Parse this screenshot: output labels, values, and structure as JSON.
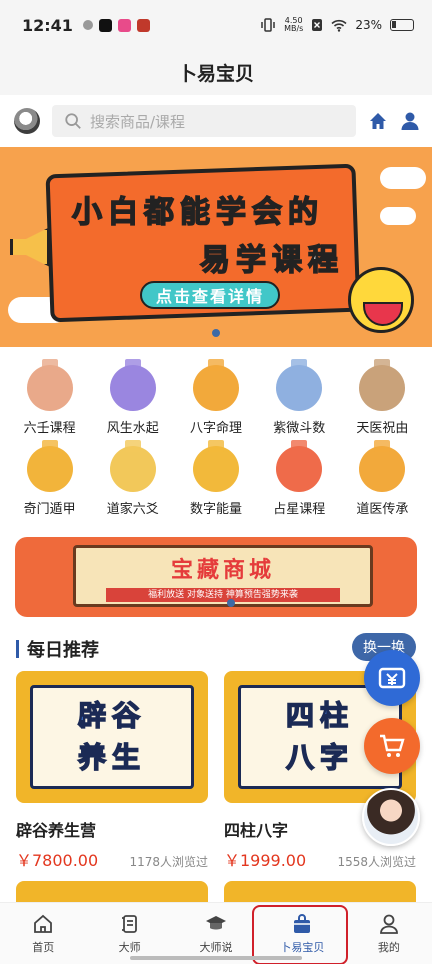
{
  "status_bar": {
    "time": "12:41",
    "net_speed_value": "4.50",
    "net_speed_unit": "MB/s",
    "battery": "23%"
  },
  "header": {
    "title": "卜易宝贝"
  },
  "search": {
    "placeholder": "搜索商品/课程"
  },
  "banner": {
    "line1": "小白都能学会的",
    "line2": "易学课程",
    "button": "点击查看详情"
  },
  "categories": [
    {
      "label": "六壬课程",
      "color": "#e9a98a"
    },
    {
      "label": "风生水起",
      "color": "#9a86e0"
    },
    {
      "label": "八字命理",
      "color": "#f2a93b"
    },
    {
      "label": "紫微斗数",
      "color": "#8fb0e0"
    },
    {
      "label": "天医祝由",
      "color": "#c9a27a"
    },
    {
      "label": "奇门遁甲",
      "color": "#f2b43b"
    },
    {
      "label": "道家六爻",
      "color": "#f2c85a"
    },
    {
      "label": "数字能量",
      "color": "#f2b93b"
    },
    {
      "label": "占星课程",
      "color": "#ef6b4a"
    },
    {
      "label": "道医传承",
      "color": "#f2a93b"
    }
  ],
  "store_banner": {
    "title": "宝藏商城",
    "subtitle": "福利放送 对象送持 神算预告强势来袭"
  },
  "recommend": {
    "title": "每日推荐",
    "refresh": "换一换"
  },
  "products": [
    {
      "art": [
        "辟谷",
        "养生"
      ],
      "name": "辟谷养生营",
      "price": "￥7800.00",
      "views": "1178人浏览过"
    },
    {
      "art": [
        "四柱",
        "八字"
      ],
      "name": "四柱八字",
      "price": "￥1999.00",
      "views": "1558人浏览过"
    }
  ],
  "tabbar": [
    {
      "label": "首页",
      "icon": "home-icon"
    },
    {
      "label": "大师",
      "icon": "scroll-icon"
    },
    {
      "label": "大师说",
      "icon": "graduation-cap-icon"
    },
    {
      "label": "卜易宝贝",
      "icon": "shopping-bag-icon",
      "active": true
    },
    {
      "label": "我的",
      "icon": "user-icon"
    }
  ]
}
